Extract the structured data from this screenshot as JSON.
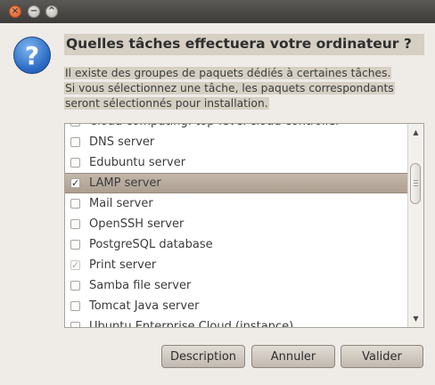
{
  "window": {
    "controls": {
      "close": "×",
      "minimize": "−",
      "maximize": "^"
    }
  },
  "dialog": {
    "icon": "question-icon",
    "icon_glyph": "?",
    "heading": "Quelles tâches effectuera votre ordinateur ?",
    "description": [
      "Il existe des groupes de paquets dédiés à certaines tâches.",
      "Si vous sélectionnez une tâche, les paquets correspondants",
      "seront sélectionnés pour installation."
    ]
  },
  "tasks": [
    {
      "label": "Cloud computing: top-level cloud controller",
      "checked": false,
      "disabled": false
    },
    {
      "label": "DNS server",
      "checked": false,
      "disabled": false
    },
    {
      "label": "Edubuntu server",
      "checked": false,
      "disabled": false
    },
    {
      "label": "LAMP server",
      "checked": true,
      "disabled": false,
      "selected": true
    },
    {
      "label": "Mail server",
      "checked": false,
      "disabled": false
    },
    {
      "label": "OpenSSH server",
      "checked": false,
      "disabled": false
    },
    {
      "label": "PostgreSQL database",
      "checked": false,
      "disabled": false
    },
    {
      "label": "Print server",
      "checked": true,
      "disabled": true
    },
    {
      "label": "Samba file server",
      "checked": false,
      "disabled": false
    },
    {
      "label": "Tomcat Java server",
      "checked": false,
      "disabled": false
    },
    {
      "label": "Ubuntu Enterprise Cloud (instance)",
      "checked": false,
      "disabled": false
    }
  ],
  "scrollbar": {
    "up_glyph": "▲",
    "down_glyph": "▼"
  },
  "buttons": {
    "description": "Description",
    "cancel": "Annuler",
    "validate": "Valider"
  },
  "colors": {
    "window_bg": "#efebe7",
    "titlebar": "#3c3b37",
    "close_button": "#e0521d",
    "selection": "#b5a899",
    "text_highlight": "#d6cfc4"
  }
}
